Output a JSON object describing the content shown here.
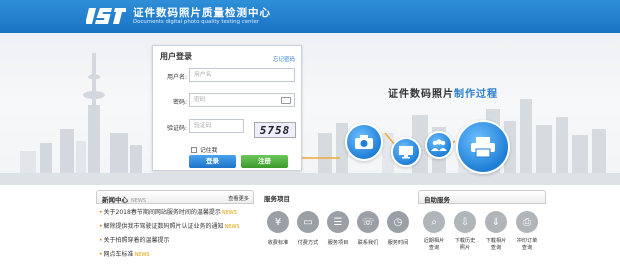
{
  "header": {
    "logo_text": "IST",
    "title": "证件数码照片质量检测中心",
    "subtitle": "Documents digital photo quality testing center"
  },
  "hero": {
    "slogan_main": "证件数码照片",
    "slogan_accent": "制作过程"
  },
  "login": {
    "title": "用户登录",
    "forgot_link": "忘记密码",
    "username_label": "用户名:",
    "username_placeholder": "用户名",
    "password_label": "密码:",
    "password_placeholder": "密码",
    "captcha_label": "验证码:",
    "captcha_placeholder": "验证码",
    "captcha_value": "5758",
    "remember_label": "记住我",
    "login_button": "登录",
    "register_button": "注册"
  },
  "news": {
    "title": "新闻中心",
    "title_en": "NEWS",
    "more": "查看更多",
    "items": [
      {
        "text": "关于2018春节期间网站服务时间的温馨提示",
        "new": "NEWS"
      },
      {
        "text": "解除提供我市驾驶证数码照片认证业务的通知",
        "new": "NEWS"
      },
      {
        "text": "关于拍照穿着的温馨提示",
        "new": ""
      },
      {
        "text": "网点车标准",
        "new": "NEWS"
      }
    ]
  },
  "services": {
    "title": "服务项目",
    "items": [
      {
        "label": "收费标准",
        "icon": "price-tag-icon"
      },
      {
        "label": "付费方式",
        "icon": "card-icon"
      },
      {
        "label": "服务项目",
        "icon": "list-icon"
      },
      {
        "label": "联系我们",
        "icon": "phone-icon"
      },
      {
        "label": "服务时间",
        "icon": "clock-icon"
      }
    ]
  },
  "self_service": {
    "title": "自助服务",
    "items": [
      {
        "label_line1": "近期相片",
        "label_line2": "查询",
        "icon": "search-icon"
      },
      {
        "label_line1": "下载历史",
        "label_line2": "照片",
        "icon": "download-icon"
      },
      {
        "label_line1": "下载相片",
        "label_line2": "查询",
        "icon": "photo-download-icon"
      },
      {
        "label_line1": "冲印订单",
        "label_line2": "查询",
        "icon": "print-order-icon"
      }
    ]
  },
  "colors": {
    "header_blue": "#1f7ccc",
    "accent_blue": "#2b7fd1",
    "login_green": "#3a9a2a"
  }
}
